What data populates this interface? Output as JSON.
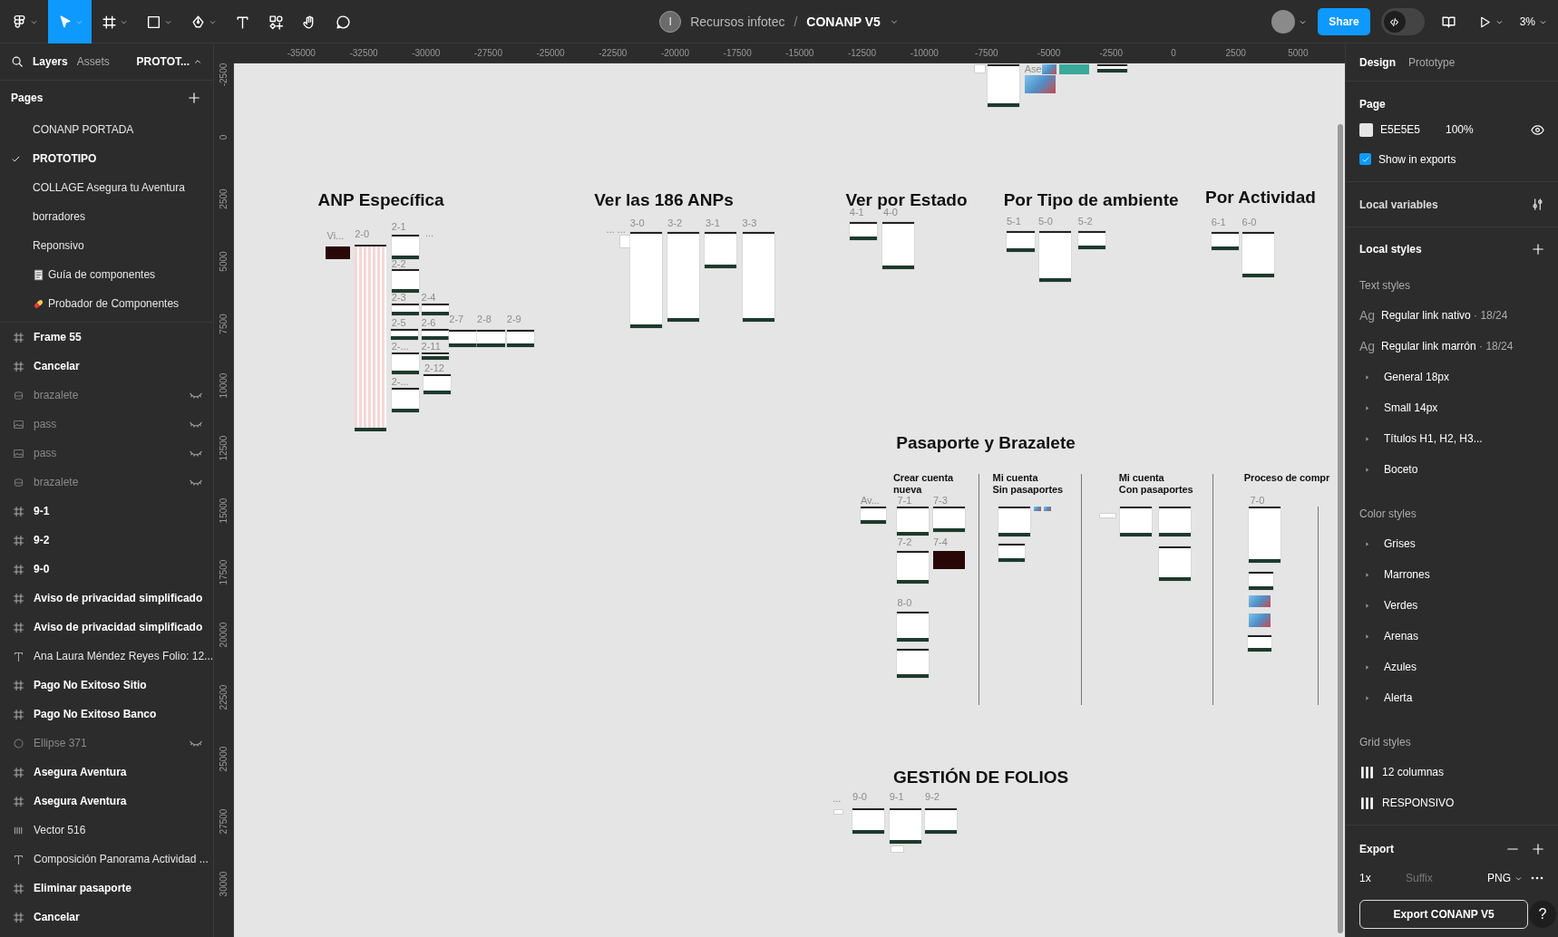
{
  "toolbar": {
    "tools": [
      {
        "kind": "logo",
        "selected": false
      },
      {
        "kind": "move",
        "selected": true
      },
      {
        "kind": "frame",
        "selected": false
      },
      {
        "kind": "shape",
        "selected": false
      },
      {
        "kind": "pen",
        "selected": false
      },
      {
        "kind": "text",
        "selected": false
      },
      {
        "kind": "resources",
        "selected": false
      },
      {
        "kind": "hand",
        "selected": false
      },
      {
        "kind": "comment",
        "selected": false
      }
    ],
    "file": {
      "team_initial": "I",
      "team": "Recursos infotec",
      "separator": "/",
      "name": "CONANP V5"
    },
    "share": "Share",
    "dev_mode": false,
    "zoom": "3%"
  },
  "left_panel": {
    "tabs": [
      {
        "label": "Layers",
        "selected": true
      },
      {
        "label": "Assets",
        "selected": false
      }
    ],
    "page_menu": "PROTOT...",
    "pages_title": "Pages",
    "pages": [
      {
        "name": "CONANP PORTADA",
        "selected": false
      },
      {
        "name": "PROTOTIPO",
        "selected": true
      },
      {
        "name": "COLLAGE Asegura tu Aventura",
        "selected": false
      },
      {
        "name": "borradores",
        "selected": false
      },
      {
        "name": "Reponsivo",
        "selected": false
      },
      {
        "name": "Guía de componentes",
        "selected": false,
        "kind": "document"
      },
      {
        "name": "Probador de Componentes",
        "selected": false,
        "kind": "pill"
      }
    ],
    "layers": [
      {
        "name": "Frame 55",
        "kind": "frame",
        "hidden": false
      },
      {
        "name": "Cancelar",
        "kind": "frame",
        "hidden": false
      },
      {
        "name": "brazalete",
        "kind": "instance",
        "hidden": true
      },
      {
        "name": "pass",
        "kind": "image",
        "hidden": true
      },
      {
        "name": "pass",
        "kind": "image",
        "hidden": true
      },
      {
        "name": "brazalete",
        "kind": "instance",
        "hidden": true
      },
      {
        "name": "9-1",
        "kind": "frame",
        "hidden": false
      },
      {
        "name": "9-2",
        "kind": "frame",
        "hidden": false
      },
      {
        "name": "9-0",
        "kind": "frame",
        "hidden": false
      },
      {
        "name": "Aviso de privacidad simplificado",
        "kind": "frame",
        "hidden": false
      },
      {
        "name": "Aviso de privacidad simplificado",
        "kind": "frame",
        "hidden": false
      },
      {
        "name": "Ana Laura Méndez Reyes Folio: 12...",
        "kind": "text",
        "hidden": false
      },
      {
        "name": "Pago No Exitoso Sitio",
        "kind": "frame",
        "hidden": false
      },
      {
        "name": "Pago No Exitoso Banco",
        "kind": "frame",
        "hidden": false
      },
      {
        "name": "Ellipse 371",
        "kind": "ellipse",
        "hidden": true
      },
      {
        "name": "Asegura Aventura",
        "kind": "frame",
        "hidden": false
      },
      {
        "name": "Asegura Aventura",
        "kind": "frame",
        "hidden": false
      },
      {
        "name": "Vector 516",
        "kind": "vector",
        "hidden": false
      },
      {
        "name": "Composición Panorama Actividad ...",
        "kind": "text",
        "hidden": false
      },
      {
        "name": "Eliminar pasaporte",
        "kind": "frame",
        "hidden": false
      },
      {
        "name": "Cancelar",
        "kind": "frame",
        "hidden": false
      }
    ]
  },
  "rulers": {
    "horizontal": [
      "-35000",
      "-32500",
      "-30000",
      "-27500",
      "-25000",
      "-22500",
      "-20000",
      "-17500",
      "-15000",
      "-12500",
      "-10000",
      "-7500",
      "-5000",
      "-2500",
      "0",
      "2500",
      "5000"
    ],
    "vertical": [
      "-2500",
      "0",
      "2500",
      "5000",
      "7500",
      "10000",
      "12500",
      "15000",
      "17500",
      "20000",
      "22500",
      "25000",
      "27500",
      "30000"
    ]
  },
  "canvas": {
    "sections": [
      {
        "frames": [
          {
            "kind": "tiny"
          },
          {
            "kind": "page"
          },
          {
            "label": "Ase",
            "kind": "photo"
          },
          {
            "kind": "photo"
          },
          {
            "kind": "teal"
          },
          {
            "kind": "page"
          }
        ]
      },
      {
        "title": "ANP Específica",
        "frames": [
          {
            "label": "Vi...",
            "kind": "dark"
          },
          {
            "label": "2-0",
            "kind": "tall"
          },
          {
            "label": "2-1",
            "kind": "page"
          },
          {
            "label": "...",
            "kind": "label"
          },
          {
            "label": "2-2",
            "kind": "page"
          },
          {
            "label": "2-3",
            "kind": "page"
          },
          {
            "label": "2-4",
            "kind": "page"
          },
          {
            "label": "2-5",
            "kind": "page"
          },
          {
            "label": "2-6",
            "kind": "page"
          },
          {
            "label": "2-7",
            "kind": "page"
          },
          {
            "label": "2-8",
            "kind": "page"
          },
          {
            "label": "2-9",
            "kind": "page"
          },
          {
            "label": "2-...",
            "kind": "page"
          },
          {
            "label": "2-11",
            "kind": "page"
          },
          {
            "label": "2-12",
            "kind": "page"
          },
          {
            "label": "2-...",
            "kind": "page"
          }
        ]
      },
      {
        "title": "Ver las 186 ANPs",
        "frames": [
          {
            "label": "... ...",
            "kind": "tiny"
          },
          {
            "label": "3-0",
            "kind": "page"
          },
          {
            "label": "3-2",
            "kind": "page"
          },
          {
            "label": "3-1",
            "kind": "page"
          },
          {
            "label": "3-3",
            "kind": "page"
          }
        ]
      },
      {
        "title": "Ver por Estado",
        "frames": [
          {
            "label": "4-1",
            "kind": "page"
          },
          {
            "label": "4-0",
            "kind": "page"
          }
        ]
      },
      {
        "title": "Por Tipo de ambiente",
        "frames": [
          {
            "label": "5-1",
            "kind": "page"
          },
          {
            "label": "5-0",
            "kind": "page"
          },
          {
            "label": "5-2",
            "kind": "page"
          }
        ]
      },
      {
        "title": "Por Actividad",
        "frames": [
          {
            "label": "6-1",
            "kind": "page"
          },
          {
            "label": "6-0",
            "kind": "page"
          }
        ]
      },
      {
        "title": "Pasaporte y Brazalete",
        "columns": [
          {
            "heading": "Crear cuenta\nnueva",
            "frames": [
              {
                "label": "Av...",
                "kind": "page"
              },
              {
                "label": "7-1",
                "kind": "page"
              },
              {
                "label": "7-3",
                "kind": "page"
              },
              {
                "label": "7-2",
                "kind": "page"
              },
              {
                "label": "7-4",
                "kind": "dark"
              },
              {
                "label": "8-0",
                "kind": "page"
              },
              {
                "kind": "page"
              }
            ]
          },
          {
            "heading": "Mi cuenta\nSin pasaportes",
            "frames": [
              {
                "kind": "page"
              },
              {
                "kind": "photo"
              },
              {
                "kind": "photo"
              },
              {
                "kind": "page"
              }
            ]
          },
          {
            "heading": "Mi cuenta\nCon pasaportes",
            "frames": [
              {
                "kind": "tiny"
              },
              {
                "kind": "page"
              },
              {
                "kind": "page"
              },
              {
                "kind": "page"
              }
            ]
          },
          {
            "heading": "Proceso de compr",
            "frames": [
              {
                "label": "7-0",
                "kind": "page"
              },
              {
                "kind": "page"
              },
              {
                "kind": "photo"
              },
              {
                "kind": "photo"
              },
              {
                "kind": "page"
              }
            ]
          }
        ]
      },
      {
        "title": "GESTIÓN DE FOLIOS",
        "frames": [
          {
            "label": "...",
            "kind": "tiny"
          },
          {
            "label": "9-0",
            "kind": "page"
          },
          {
            "label": "9-1",
            "kind": "page"
          },
          {
            "kind": "tiny"
          },
          {
            "label": "9-2",
            "kind": "page"
          }
        ]
      }
    ]
  },
  "right_panel": {
    "tabs": [
      {
        "label": "Design",
        "selected": true
      },
      {
        "label": "Prototype",
        "selected": false
      }
    ],
    "page": {
      "title": "Page",
      "color": "#e5e5e5",
      "hex": "E5E5E5",
      "opacity": "100%",
      "show_in_exports": {
        "label": "Show in exports",
        "checked": true
      }
    },
    "local_variables": "Local variables",
    "local_styles": {
      "title": "Local styles",
      "groups": [
        {
          "title": "Text styles",
          "items": [
            {
              "kind": "text",
              "sample": "Ag",
              "name": "Regular link nativo",
              "meta": "· 18/24"
            },
            {
              "kind": "text",
              "sample": "Ag",
              "name": "Regular link marrón",
              "meta": "· 18/24"
            },
            {
              "kind": "folder",
              "name": "General 18px"
            },
            {
              "kind": "folder",
              "name": "Small 14px"
            },
            {
              "kind": "folder",
              "name": "Títulos H1, H2, H3..."
            },
            {
              "kind": "folder",
              "name": "Boceto"
            }
          ]
        },
        {
          "title": "Color styles",
          "items": [
            {
              "kind": "folder",
              "name": "Grises"
            },
            {
              "kind": "folder",
              "name": "Marrones"
            },
            {
              "kind": "folder",
              "name": "Verdes"
            },
            {
              "kind": "folder",
              "name": "Arenas"
            },
            {
              "kind": "folder",
              "name": "Azules"
            },
            {
              "kind": "folder",
              "name": "Alerta"
            }
          ]
        },
        {
          "title": "Grid styles",
          "items": [
            {
              "kind": "grid",
              "name": "12 columnas"
            },
            {
              "kind": "grid",
              "name": "RESPONSIVO"
            }
          ]
        }
      ]
    },
    "export": {
      "title": "Export",
      "scale": "1x",
      "suffix_placeholder": "Suffix",
      "format": "PNG",
      "button": "Export CONANP V5"
    },
    "help": "?"
  }
}
